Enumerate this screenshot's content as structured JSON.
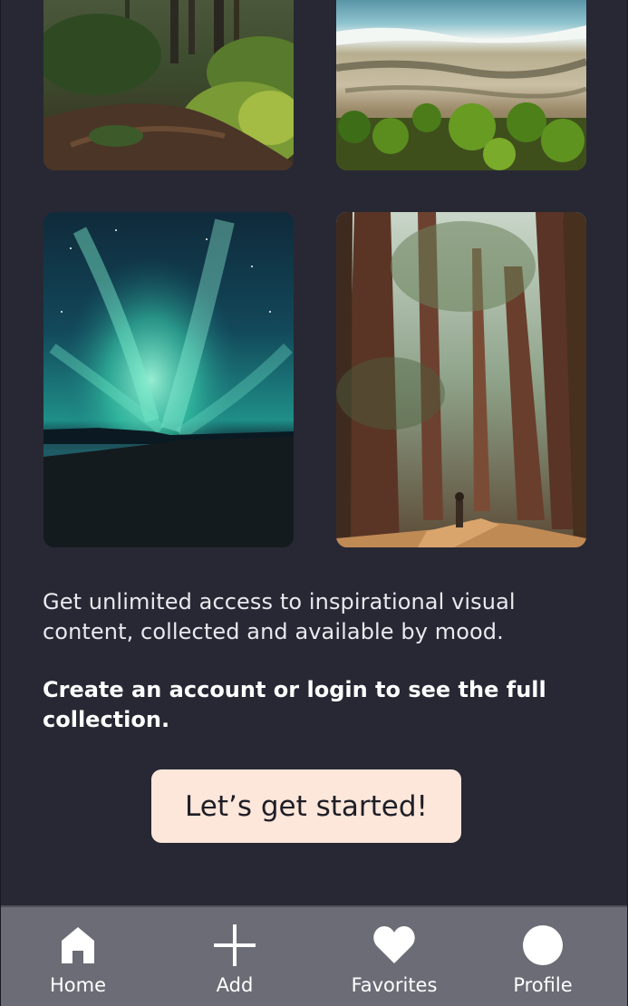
{
  "gallery": {
    "tiles": [
      {
        "name": "forest-photo",
        "subject": "forest trail with sunlit ferns"
      },
      {
        "name": "coast-photo",
        "subject": "aerial view of waves and palm trees"
      },
      {
        "name": "aurora-photo",
        "subject": "green northern lights over a lake"
      },
      {
        "name": "redwood-photo",
        "subject": "person on a path among tall redwoods"
      }
    ]
  },
  "content": {
    "intro": "Get unlimited access to inspirational visual content, collected and available by mood.",
    "cta": "Create an account or login to see the full collection.",
    "start_button": "Let’s get started!"
  },
  "tabbar": {
    "items": [
      {
        "label": "Home",
        "icon": "home-icon"
      },
      {
        "label": "Add",
        "icon": "plus-icon"
      },
      {
        "label": "Favorites",
        "icon": "heart-icon"
      },
      {
        "label": "Profile",
        "icon": "profile-icon"
      }
    ]
  },
  "colors": {
    "background": "#272834",
    "button": "#fde6da",
    "tabbar": "#6b6c75",
    "text": "#ffffff"
  }
}
